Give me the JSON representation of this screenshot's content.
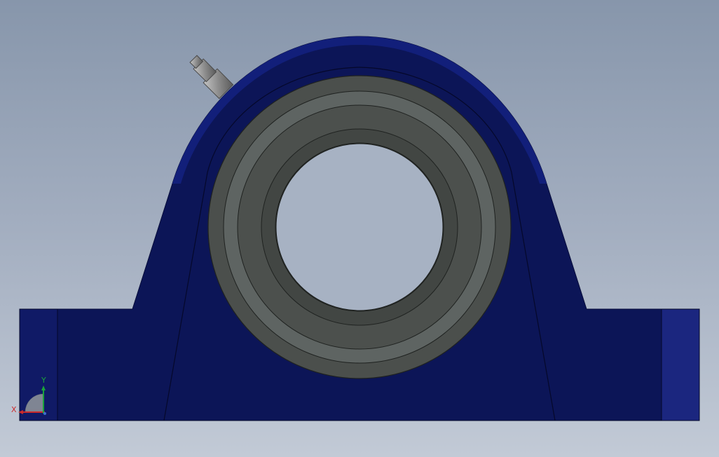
{
  "viewport": {
    "background_top": "#8796ab",
    "background_bottom": "#c2cad6"
  },
  "model": {
    "part": "pillow-block-bearing",
    "view": "front",
    "housing_color": "#0c1557",
    "housing_edge_color": "#0a1250",
    "housing_highlight_color": "#17237a",
    "insert_outer_color": "#4b4f4c",
    "insert_ring_color": "#5e6462",
    "grease_fitting_color": "#9a9a9a",
    "visible_features": [
      "housing",
      "base-feet",
      "bearing-insert",
      "bore",
      "grease-fitting"
    ]
  },
  "triad": {
    "x_label": "X",
    "y_label": "Y",
    "x_color": "#cc2a2a",
    "y_color": "#1aa33a"
  }
}
